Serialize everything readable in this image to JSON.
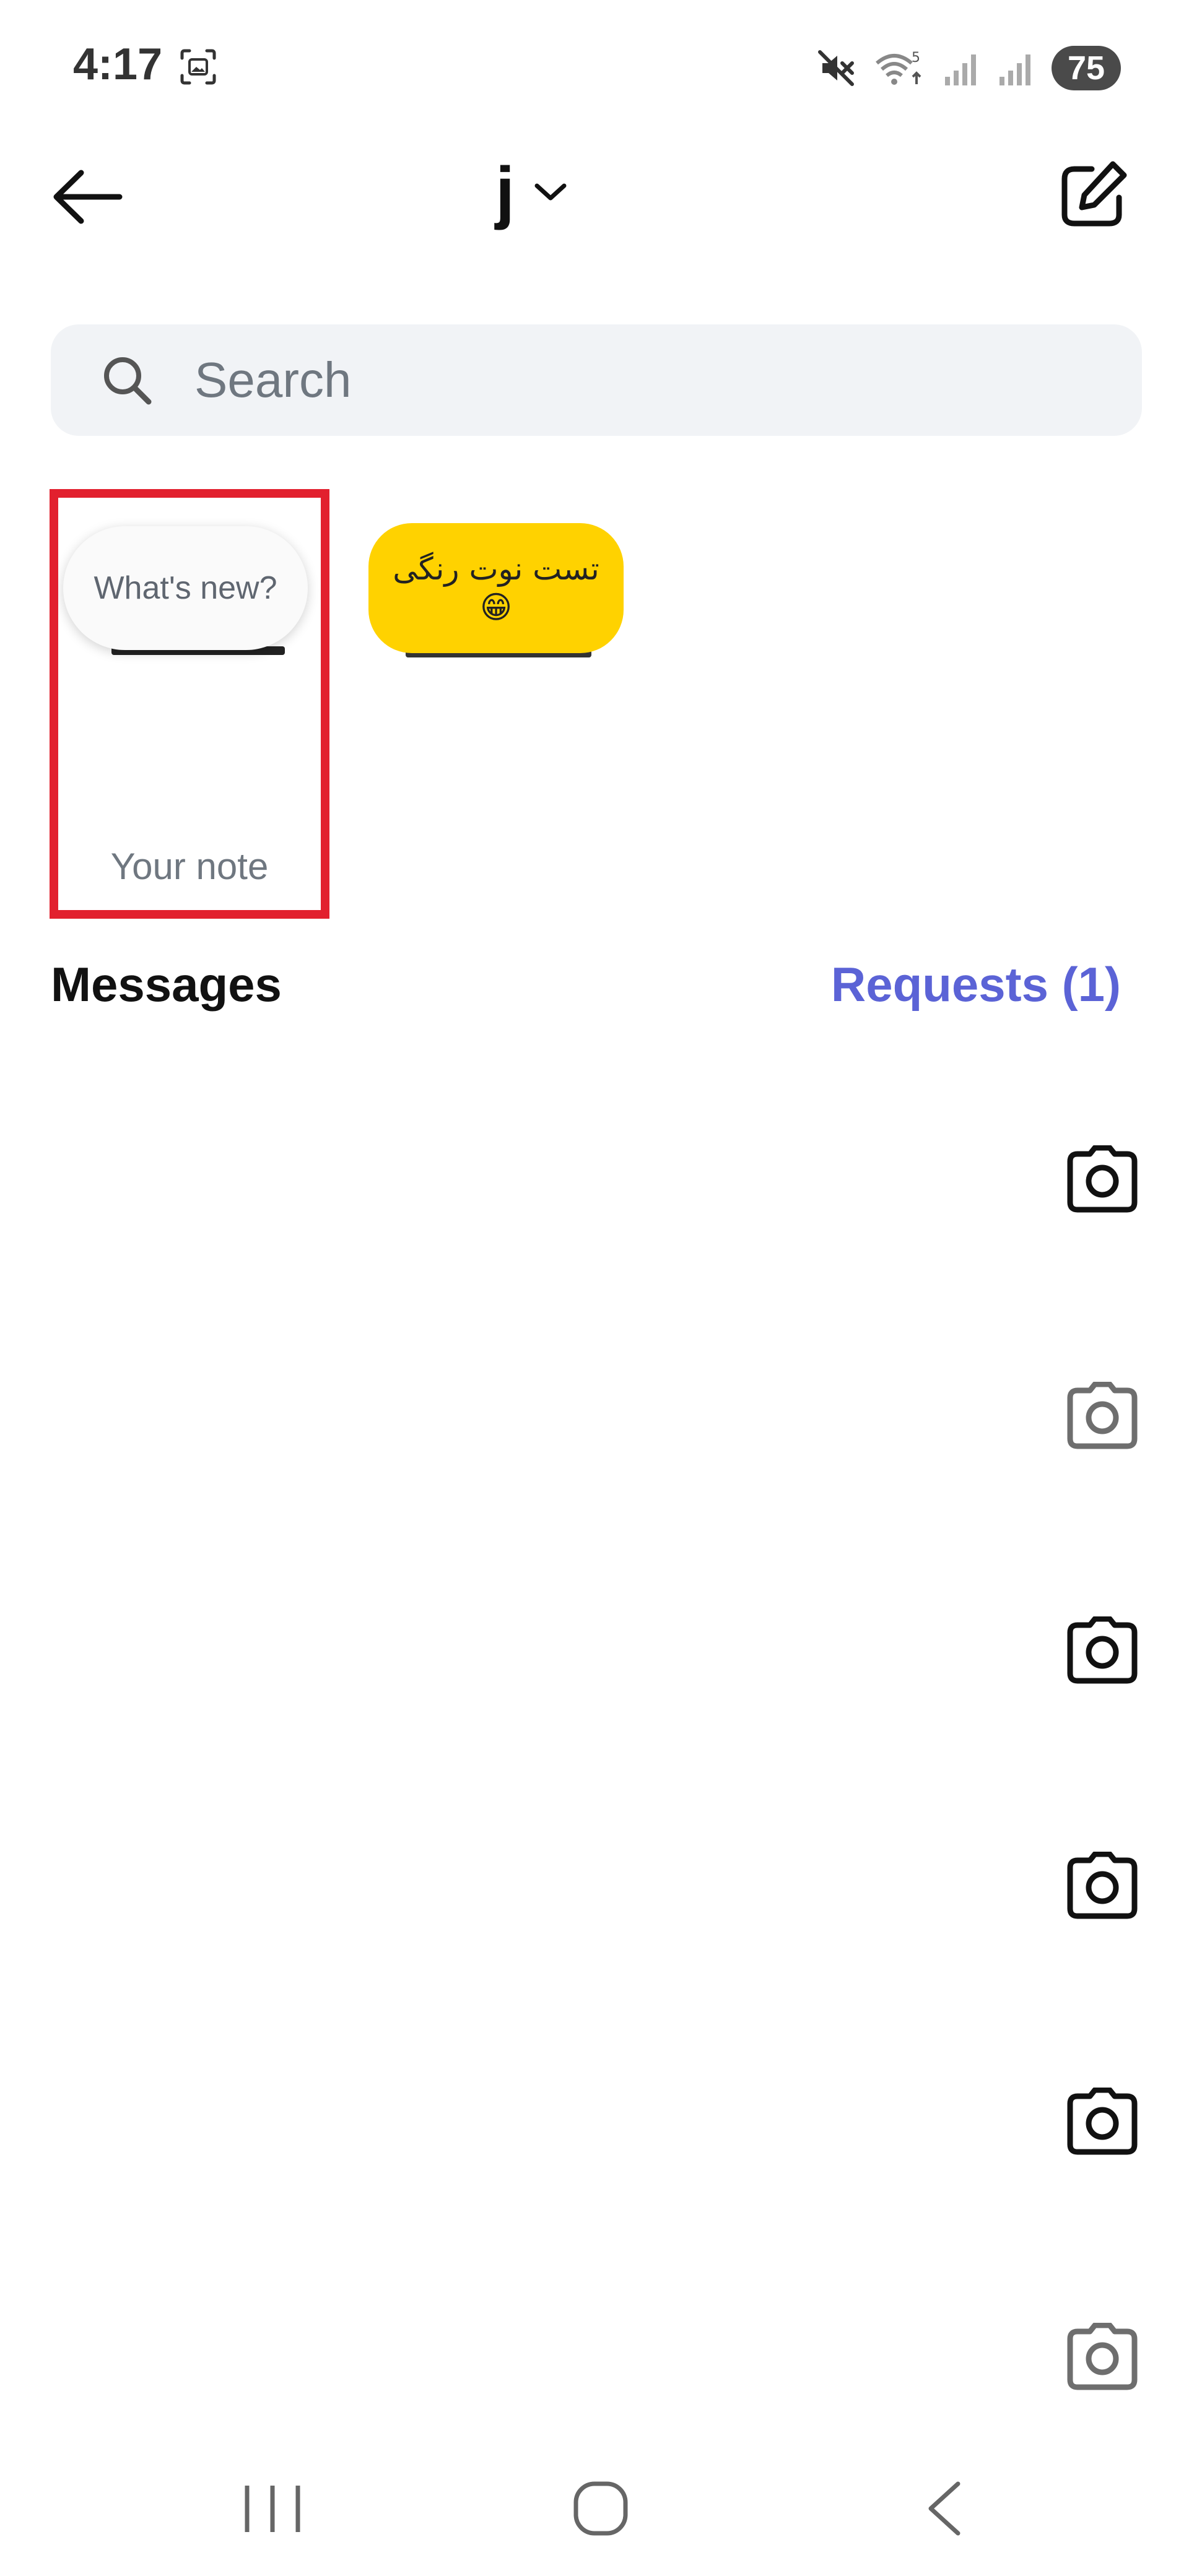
{
  "status_bar": {
    "time": "4:17",
    "battery": "75",
    "icons": [
      "screenshot-icon",
      "mute-icon",
      "wifi-icon",
      "signal-icon",
      "signal-icon"
    ]
  },
  "header": {
    "account_name": "j",
    "icons": [
      "back-arrow-icon",
      "chevron-down-icon",
      "compose-icon"
    ]
  },
  "search": {
    "placeholder": "Search"
  },
  "notes": {
    "self": {
      "bubble_text": "What's new?",
      "label": "Your note"
    },
    "friend": {
      "line1": "تست نوت رنگی",
      "line2": "😁",
      "bubble_color": "#ffd200"
    }
  },
  "messages": {
    "heading": "Messages",
    "requests_label": "Requests (1)",
    "requests_color": "#5b63d6"
  },
  "highlight_color": "#e2202e"
}
